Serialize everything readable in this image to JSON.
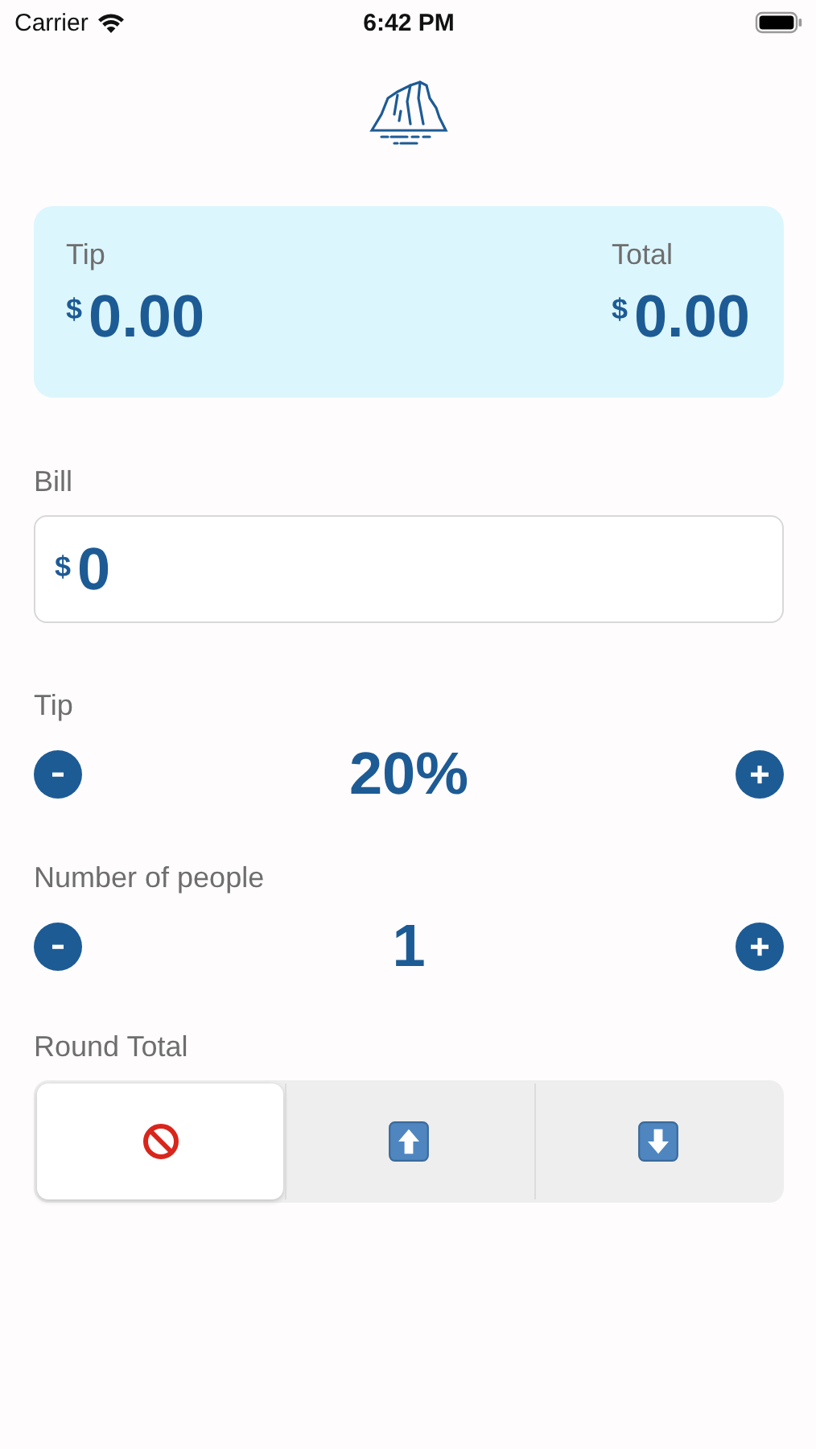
{
  "status_bar": {
    "carrier": "Carrier",
    "time": "6:42 PM"
  },
  "summary": [
    {
      "label": "Tip",
      "currency": "$",
      "amount": "0.00"
    },
    {
      "label": "Total",
      "currency": "$",
      "amount": "0.00"
    }
  ],
  "bill": {
    "label": "Bill",
    "currency": "$",
    "value": "0"
  },
  "steppers": [
    {
      "label": "Tip",
      "value": "20%"
    },
    {
      "label": "Number of people",
      "value": "1"
    }
  ],
  "round_total": {
    "label": "Round Total",
    "segments": [
      {
        "kind": "none",
        "selected": true
      },
      {
        "kind": "up",
        "selected": false
      },
      {
        "kind": "down",
        "selected": false
      }
    ]
  }
}
